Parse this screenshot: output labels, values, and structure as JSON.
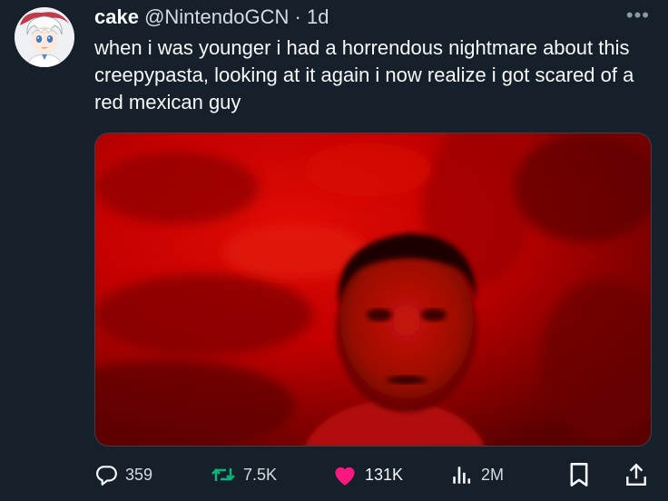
{
  "tweet": {
    "author_name": "cake",
    "handle": "@NintendoGCN",
    "separator": "·",
    "time": "1d",
    "more_label": "•••",
    "text": "when i was younger i had a horrendous nightmare about this creepypasta, looking at it again i now realize i got scared of a red mexican guy"
  },
  "actions": {
    "replies": "359",
    "retweets": "7.5K",
    "likes": "131K",
    "views": "2M"
  },
  "colors": {
    "background": "#15202b",
    "text": "#f7f9f9",
    "secondary": "#8b98a5",
    "retweet": "#00ba7c",
    "like": "#f91880",
    "media_red": "#d10000"
  },
  "icons": {
    "reply": "speech-bubble-icon",
    "retweet": "retweet-icon",
    "like": "heart-icon",
    "views": "bar-chart-icon",
    "bookmark": "bookmark-icon",
    "share": "share-icon"
  }
}
